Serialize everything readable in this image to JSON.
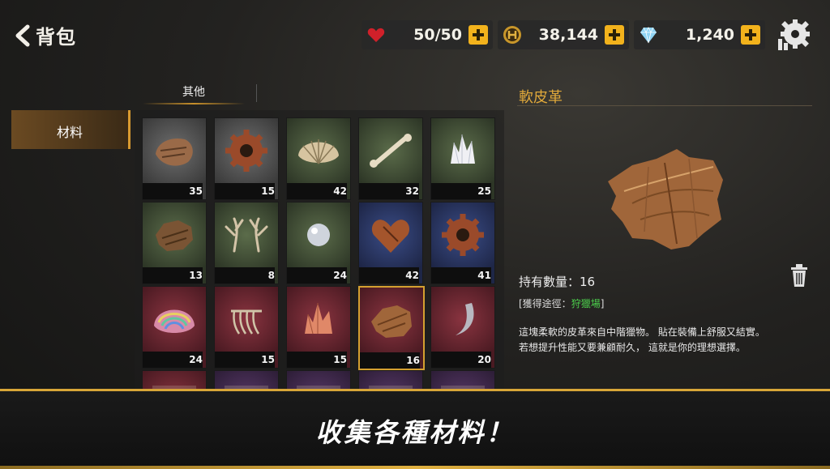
{
  "header": {
    "back_label": "背包"
  },
  "resources": [
    {
      "icon": "heart-icon",
      "value": "50/50"
    },
    {
      "icon": "gold-coin-icon",
      "value": "38,144"
    },
    {
      "icon": "diamond-icon",
      "value": "1,240"
    }
  ],
  "tabs": {
    "top": "其他",
    "side": "材料"
  },
  "slots": [
    {
      "item": "rusty-fragment",
      "rarity": "grey",
      "count": "35"
    },
    {
      "item": "gear",
      "rarity": "grey",
      "count": "15"
    },
    {
      "item": "shell",
      "rarity": "green",
      "count": "42"
    },
    {
      "item": "bone",
      "rarity": "green",
      "count": "32"
    },
    {
      "item": "crystal",
      "rarity": "green",
      "count": "25"
    },
    {
      "item": "leather-scrap",
      "rarity": "green",
      "count": "13"
    },
    {
      "item": "antler",
      "rarity": "green",
      "count": "8"
    },
    {
      "item": "pearl",
      "rarity": "green",
      "count": "24"
    },
    {
      "item": "heart",
      "rarity": "blue",
      "count": "42"
    },
    {
      "item": "gear",
      "rarity": "blue",
      "count": "41"
    },
    {
      "item": "rainbow-shell",
      "rarity": "red",
      "count": "24"
    },
    {
      "item": "ribcage",
      "rarity": "red",
      "count": "15"
    },
    {
      "item": "red-crystal",
      "rarity": "red",
      "count": "15"
    },
    {
      "item": "soft-leather",
      "rarity": "red",
      "count": "16"
    },
    {
      "item": "claw",
      "rarity": "red",
      "count": "20"
    },
    {
      "item": "partial",
      "rarity": "red",
      "count": ""
    },
    {
      "item": "partial",
      "rarity": "purple",
      "count": ""
    },
    {
      "item": "partial",
      "rarity": "purple",
      "count": ""
    },
    {
      "item": "partial",
      "rarity": "purple",
      "count": ""
    },
    {
      "item": "partial",
      "rarity": "purple",
      "count": ""
    }
  ],
  "detail": {
    "name": "軟皮革",
    "quantity": "持有數量：16",
    "source_prefix": "[獲得途徑：",
    "source_name": "狩獵場",
    "source_suffix": "]",
    "description": "這塊柔軟的皮革來自中階獵物。 貼在裝備上舒服又結實。\n若想提升性能又要兼顧耐久， 這就是你的理想選擇。"
  },
  "banner": {
    "text": "收集各種材料！"
  },
  "colors": {
    "accent": "#d8a638",
    "source_green": "#4cd04c"
  }
}
